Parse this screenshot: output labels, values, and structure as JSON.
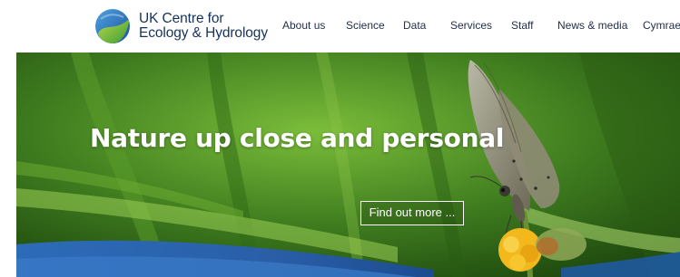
{
  "logo": {
    "line1": "UK Centre for",
    "line2": "Ecology & Hydrology"
  },
  "nav": {
    "items": [
      {
        "label": "About us"
      },
      {
        "label": "Science"
      },
      {
        "label": "Data"
      },
      {
        "label": "Services"
      },
      {
        "label": "Staff"
      },
      {
        "label": "News & media"
      },
      {
        "label": "Cymraeg"
      }
    ]
  },
  "hero": {
    "title": "Nature up close and personal",
    "button_label": "Find out more ..."
  },
  "colors": {
    "brand_navy": "#16325c",
    "nav_text": "#23304a",
    "hero_green": "#3f7d1f",
    "wave_blue": "#2a5fa8"
  }
}
